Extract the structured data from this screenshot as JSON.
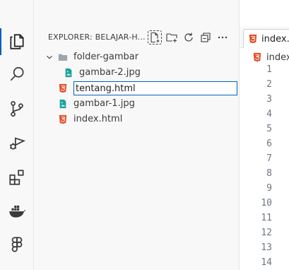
{
  "explorer": {
    "title": "EXPLORER: BELAJAR-H...",
    "tree": [
      {
        "type": "folder",
        "name": "folder-gambar"
      },
      {
        "type": "image",
        "name": "gambar-2.jpg"
      },
      {
        "type": "html",
        "name": "tentang.html",
        "editing": true
      },
      {
        "type": "image",
        "name": "gambar-1.jpg"
      },
      {
        "type": "html",
        "name": "index.html"
      }
    ]
  },
  "editor": {
    "tab_label": "index.h",
    "breadcrumb": "index",
    "line_numbers": [
      "1",
      "2",
      "3",
      "4",
      "5",
      "6",
      "7",
      "8",
      "9",
      "10",
      "11",
      "12",
      "13",
      "14"
    ]
  },
  "colors": {
    "html_icon": "#e44d26",
    "image_icon": "#1ba39c",
    "folder_icon": "#9aa5ad",
    "accent": "#005fb8"
  }
}
